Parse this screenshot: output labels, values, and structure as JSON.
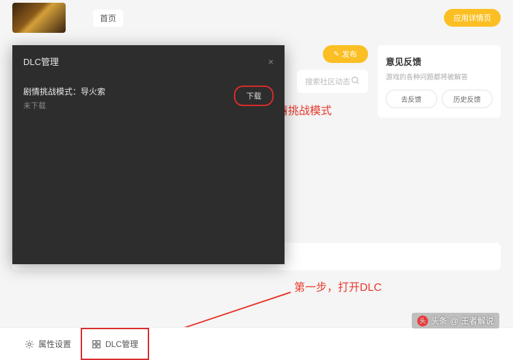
{
  "top": {
    "home": "首页",
    "detail": "应用详情页"
  },
  "modal": {
    "title": "DLC管理",
    "close": "×",
    "dlc_name": "剧情挑战模式：导火索",
    "dlc_status": "未下载",
    "download": "下载"
  },
  "center": {
    "publish": "发布",
    "search_placeholder": "搜索社区动态"
  },
  "feedback": {
    "title": "意见反馈",
    "sub": "游戏的各种问题都将被解答",
    "btn1": "去反馈",
    "btn2": "历史反馈"
  },
  "annotations": {
    "a1": "下载剧情挑战模式",
    "a2": "第一步，打开DLC"
  },
  "tabs": {
    "properties": "属性设置",
    "dlc": "DLC管理"
  },
  "watermark": {
    "prefix": "头条",
    "at": "@",
    "name": "王者解说"
  }
}
